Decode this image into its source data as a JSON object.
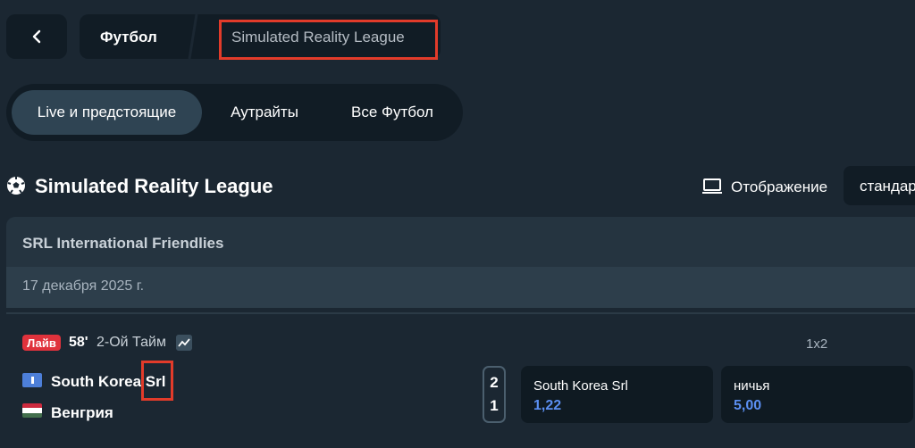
{
  "breadcrumb": {
    "items": [
      "Футбол",
      "Simulated Reality League"
    ]
  },
  "tabs": [
    {
      "label": "Live и предстоящие",
      "active": true
    },
    {
      "label": "Аутрайты",
      "active": false
    },
    {
      "label": "Все Футбол",
      "active": false
    }
  ],
  "league": {
    "title": "Simulated Reality League",
    "display_label": "Отображение",
    "display_value": "стандартный"
  },
  "competition": {
    "name": "SRL International Friendlies",
    "date": "17 декабря 2025 г."
  },
  "event": {
    "live_badge": "Лайв",
    "minute": "58'",
    "period": "2-Ой Тайм",
    "market_label": "1x2",
    "teams": [
      {
        "name": "South Korea Srl",
        "score": "2"
      },
      {
        "name": "Венгрия",
        "score": "1"
      }
    ],
    "odds": [
      {
        "label": "South Korea Srl",
        "value": "1,22"
      },
      {
        "label": "ничья",
        "value": "5,00"
      }
    ]
  },
  "colors": {
    "background": "#1b2732",
    "panel": "#111c25",
    "active_tab": "#2f4453",
    "live_red": "#e0323c",
    "odds_blue": "#5b8ff2",
    "highlight_red": "#e23b2a"
  },
  "icons": [
    "chevron-left-icon",
    "soccer-ball-icon",
    "monitor-icon",
    "stats-chart-icon",
    "korea-flag-icon",
    "hungary-flag-icon"
  ]
}
